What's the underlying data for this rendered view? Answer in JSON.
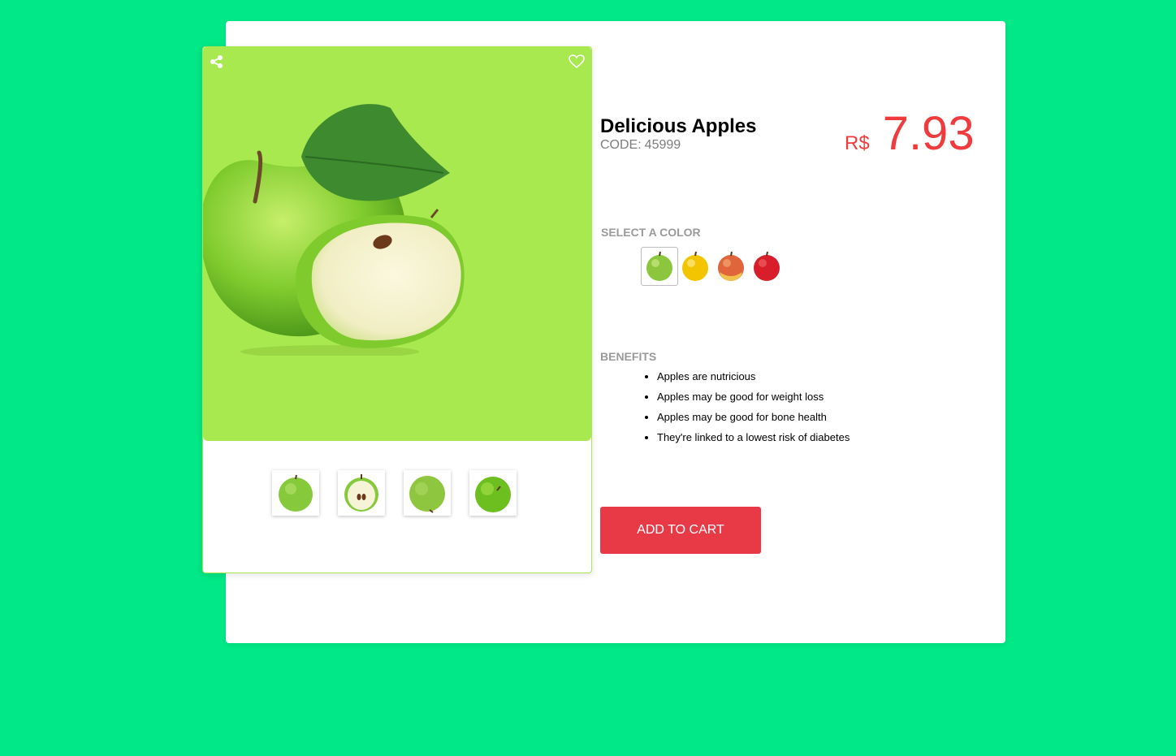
{
  "product": {
    "title": "Delicious Apples",
    "code_label": "CODE:",
    "code_value": "45999",
    "currency": "R$",
    "price": "7.93"
  },
  "colors": {
    "label": "SELECT A COLOR",
    "options": [
      {
        "name": "green-apple",
        "fill": "#8cc63f",
        "selected": true
      },
      {
        "name": "yellow-apple",
        "fill": "#f2c500",
        "selected": false
      },
      {
        "name": "red-yellow-apple",
        "fill": "#e0653a",
        "selected": false
      },
      {
        "name": "red-apple",
        "fill": "#d81e2b",
        "selected": false
      }
    ]
  },
  "benefits": {
    "label": "BENEFITS",
    "items": [
      "Apples are nutricious",
      "Apples may be good for weight loss",
      "Apples may be good for bone health",
      "They're linked to a lowest risk of diabetes"
    ]
  },
  "actions": {
    "add_to_cart": "ADD TO CART"
  },
  "icons": {
    "share": "share-icon",
    "favorite": "heart-icon"
  },
  "theme": {
    "page_background": "#00e887",
    "hero_background": "#a8e94f",
    "price_color": "#ef3b3e",
    "button_color": "#e83a46"
  }
}
